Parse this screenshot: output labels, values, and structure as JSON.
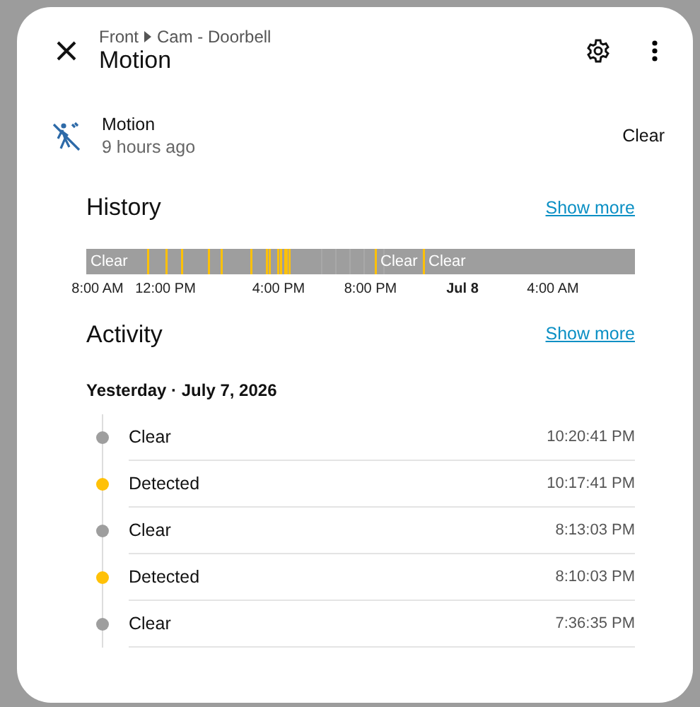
{
  "dialog": {
    "breadcrumb": [
      "Front",
      "Cam - Doorbell"
    ],
    "title": "Motion"
  },
  "entity": {
    "name": "Motion",
    "last_changed": "9 hours ago",
    "state": "Clear"
  },
  "history": {
    "title": "History",
    "show_more": "Show more",
    "segment_labels": [
      "Clear",
      "Clear",
      "Clear"
    ],
    "axis_labels": [
      {
        "text": "8:00 AM",
        "kind": "time"
      },
      {
        "text": "12:00 PM",
        "kind": "time"
      },
      {
        "text": "4:00 PM",
        "kind": "time"
      },
      {
        "text": "8:00 PM",
        "kind": "time"
      },
      {
        "text": "Jul 8",
        "kind": "date"
      },
      {
        "text": "4:00 AM",
        "kind": "time"
      }
    ]
  },
  "activity": {
    "title": "Activity",
    "show_more": "Show more",
    "day": "Yesterday · July 7, 2026",
    "events": [
      {
        "state": "Clear",
        "time": "10:20:41 PM",
        "color": "#9e9e9e"
      },
      {
        "state": "Detected",
        "time": "10:17:41 PM",
        "color": "#ffc107"
      },
      {
        "state": "Clear",
        "time": "8:13:03 PM",
        "color": "#9e9e9e"
      },
      {
        "state": "Detected",
        "time": "8:10:03 PM",
        "color": "#ffc107"
      },
      {
        "state": "Clear",
        "time": "7:36:35 PM",
        "color": "#9e9e9e"
      }
    ]
  }
}
